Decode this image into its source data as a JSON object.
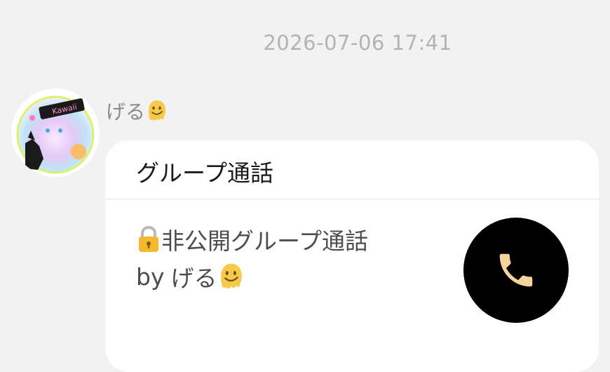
{
  "message": {
    "timestamp": "2026-07-06 17:41",
    "sender_name": "げる",
    "sender_emoji": "melting-face-icon"
  },
  "call_card": {
    "title": "グループ通話",
    "lock_icon": "lock-icon",
    "description": "非公開グループ通話",
    "by_prefix": "by",
    "by_name": "げる",
    "by_emoji": "melting-face-icon",
    "call_icon": "phone-icon",
    "colors": {
      "call_button_bg": "#000000",
      "phone_icon": "#f7d39a",
      "card_bg": "#ffffff",
      "page_bg": "#f2f2f2"
    }
  }
}
